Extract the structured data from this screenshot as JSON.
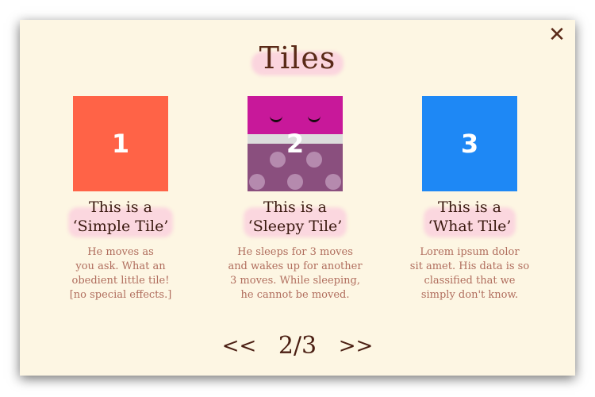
{
  "dialog": {
    "title": "Tiles",
    "close_label": "✕"
  },
  "tiles": [
    {
      "number": "1",
      "kind": "simple",
      "color": "#ff6347",
      "label_lines": [
        "This is a",
        "‘Simple Tile’"
      ],
      "desc_lines": [
        "He moves as",
        "you ask. What an",
        "obedient little tile!",
        "[no special effects.]"
      ]
    },
    {
      "number": "2",
      "kind": "sleepy",
      "color": "#8a4f7e",
      "top_color": "#c8189a",
      "label_lines": [
        "This is a",
        "‘Sleepy Tile’"
      ],
      "desc_lines": [
        "He sleeps for 3 moves",
        "and wakes up for another",
        "3 moves. While sleeping,",
        "he cannot be moved."
      ]
    },
    {
      "number": "3",
      "kind": "what",
      "color": "#1e88f5",
      "label_lines": [
        "This is a",
        "‘What Tile’"
      ],
      "desc_lines": [
        "Lorem ipsum dolor",
        "sit amet. His data is so",
        "classified that we",
        "simply don't know."
      ]
    }
  ],
  "pager": {
    "prev_label": "<<",
    "page_text": "2/3",
    "next_label": ">>",
    "current_page": 2,
    "total_pages": 3
  }
}
